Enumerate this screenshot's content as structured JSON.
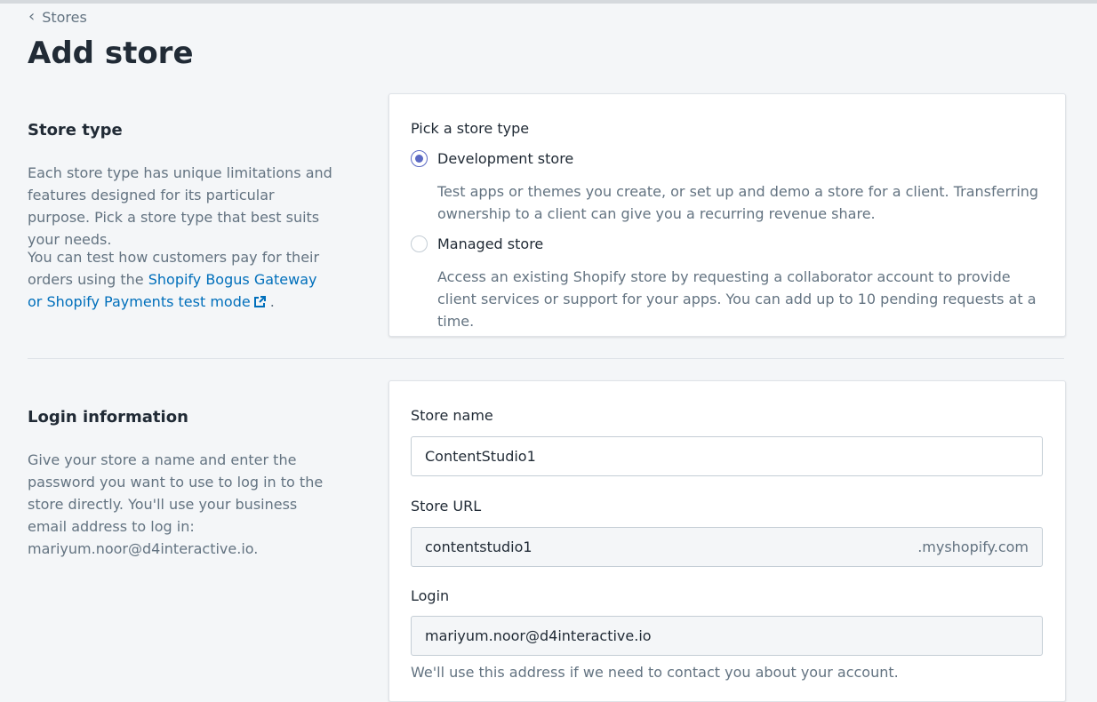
{
  "breadcrumb": {
    "label": "Stores"
  },
  "page": {
    "title": "Add store"
  },
  "store_type_section": {
    "heading": "Store type",
    "description": "Each store type has unique limitations and features designed for its particular purpose. Pick a store type that best suits your needs.",
    "test_text_before": "You can test how customers pay for their orders using the ",
    "test_link": "Shopify Bogus Gateway or Shopify Payments test mode",
    "test_text_after": " .",
    "card": {
      "group_label": "Pick a store type",
      "options": [
        {
          "label": "Development store",
          "selected": true,
          "help": "Test apps or themes you create, or set up and demo a store for a client. Transferring ownership to a client can give you a recurring revenue share."
        },
        {
          "label": "Managed store",
          "selected": false,
          "help": "Access an existing Shopify store by requesting a collaborator account to provide client services or support for your apps. You can add up to 10 pending requests at a time."
        }
      ]
    }
  },
  "login_section": {
    "heading": "Login information",
    "description": "Give your store a name and enter the password you want to use to log in to the store directly. You'll use your business email address to log in: mariyum.noor@d4interactive.io.",
    "card": {
      "store_name": {
        "label": "Store name",
        "value": "ContentStudio1"
      },
      "store_url": {
        "label": "Store URL",
        "value": "contentstudio1",
        "suffix": ".myshopify.com"
      },
      "login": {
        "label": "Login",
        "value": "mariyum.noor@d4interactive.io",
        "note": "We'll use this address if we need to contact you about your account."
      }
    }
  },
  "colors": {
    "accent": "#5c6ac4",
    "link": "#006fbb",
    "muted_text": "#637381",
    "background": "#f4f6f8"
  }
}
